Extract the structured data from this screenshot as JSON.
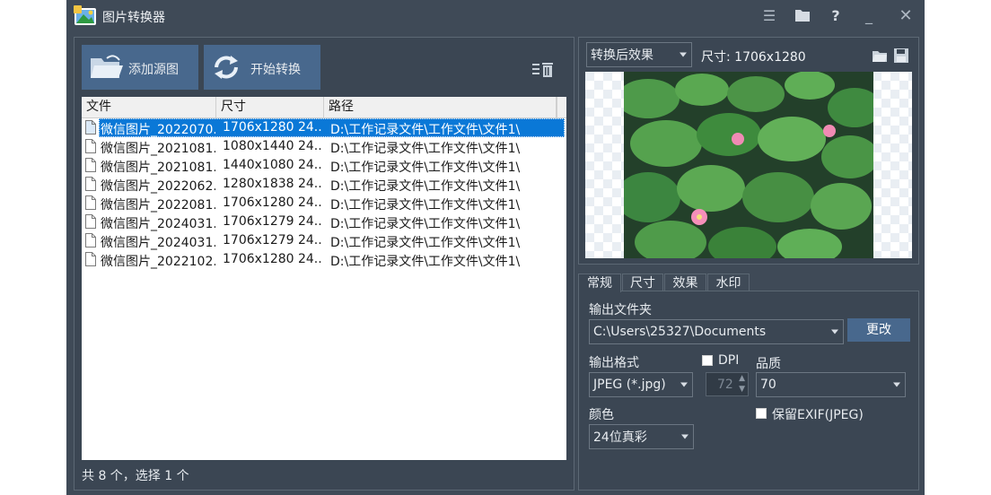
{
  "window": {
    "title": "图片转换器"
  },
  "toolbar": {
    "add_source_label": "添加源图",
    "start_convert_label": "开始转换"
  },
  "list": {
    "columns": [
      "文件",
      "尺寸",
      "路径"
    ],
    "rows": [
      {
        "name": "微信图片_2022070...",
        "size": "1706x1280  24...",
        "path": "D:\\工作记录文件\\工作文件\\文件1\\",
        "selected": true
      },
      {
        "name": "微信图片_2021081...",
        "size": "1080x1440  24...",
        "path": "D:\\工作记录文件\\工作文件\\文件1\\"
      },
      {
        "name": "微信图片_2021081...",
        "size": "1440x1080  24...",
        "path": "D:\\工作记录文件\\工作文件\\文件1\\"
      },
      {
        "name": "微信图片_2022062...",
        "size": "1280x1838  24...",
        "path": "D:\\工作记录文件\\工作文件\\文件1\\"
      },
      {
        "name": "微信图片_2022081...",
        "size": "1706x1280  24...",
        "path": "D:\\工作记录文件\\工作文件\\文件1\\"
      },
      {
        "name": "微信图片_2024031...",
        "size": "1706x1279  24...",
        "path": "D:\\工作记录文件\\工作文件\\文件1\\"
      },
      {
        "name": "微信图片_2024031...",
        "size": "1706x1279  24...",
        "path": "D:\\工作记录文件\\工作文件\\文件1\\"
      },
      {
        "name": "微信图片_2022102...",
        "size": "1706x1280  24...",
        "path": "D:\\工作记录文件\\工作文件\\文件1\\"
      }
    ]
  },
  "status_text": "共 8 个，选择 1 个",
  "preview": {
    "mode": "转换后效果",
    "size_text": "尺寸: 1706x1280"
  },
  "tabs": [
    "常规",
    "尺寸",
    "效果",
    "水印"
  ],
  "settings": {
    "output_folder_label": "输出文件夹",
    "output_folder": "C:\\Users\\25327\\Documents",
    "change_label": "更改",
    "format_label": "输出格式",
    "format": "JPEG (*.jpg)",
    "dpi_label": "DPI",
    "dpi_value": "72",
    "quality_label": "品质",
    "quality": "70",
    "color_label": "颜色",
    "color": "24位真彩",
    "exif_label": "保留EXIF(JPEG)"
  },
  "colors": {
    "window_bg": "#3f4a57",
    "button_bg": "#48688d",
    "selection": "#0a78d7"
  },
  "icons": [
    "app-icon",
    "menu-icon",
    "folder-icon",
    "help-icon",
    "minimize-icon",
    "close-icon",
    "open-folder-icon",
    "refresh-icon",
    "list-delete-icon",
    "file-icon",
    "save-icon"
  ]
}
